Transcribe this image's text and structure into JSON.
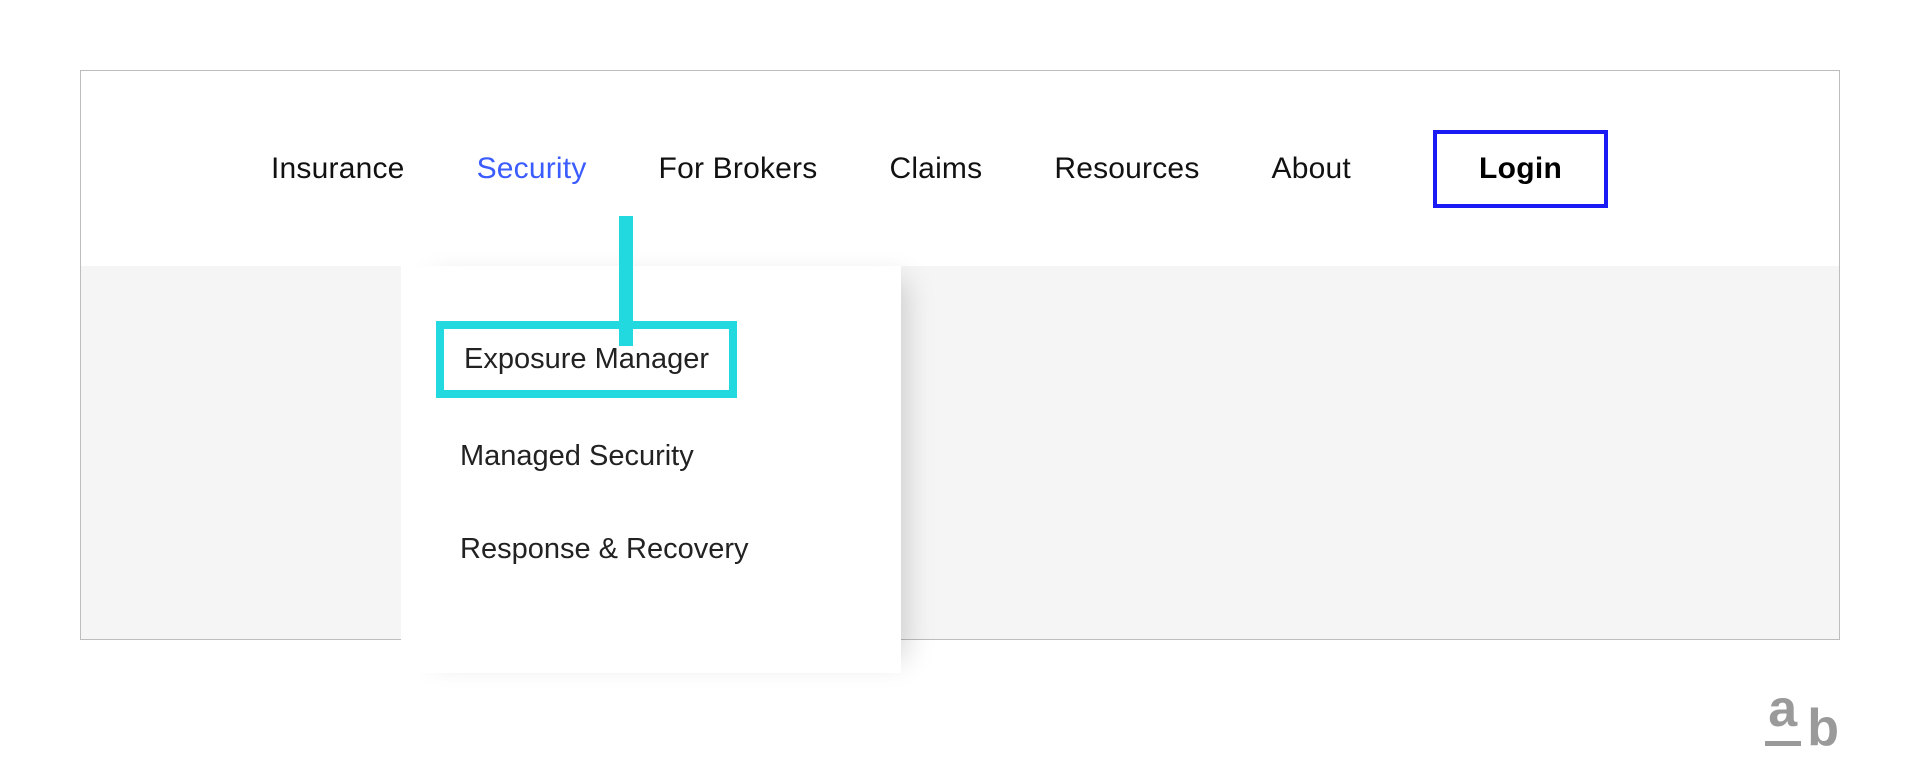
{
  "nav": {
    "items": [
      {
        "label": "Insurance",
        "active": false
      },
      {
        "label": "Security",
        "active": true
      },
      {
        "label": "For Brokers",
        "active": false
      },
      {
        "label": "Claims",
        "active": false
      },
      {
        "label": "Resources",
        "active": false
      },
      {
        "label": "About",
        "active": false
      }
    ],
    "login_label": "Login"
  },
  "dropdown": {
    "parent": "Security",
    "items": [
      {
        "label": "Exposure Manager",
        "highlighted": true
      },
      {
        "label": "Managed Security",
        "highlighted": false
      },
      {
        "label": "Response & Recovery",
        "highlighted": false
      }
    ]
  },
  "mark": {
    "a": "a",
    "b": "b"
  },
  "colors": {
    "accent_blue": "#1a1af5",
    "nav_active": "#3b5cff",
    "highlight_cyan": "#22d9e0",
    "content_bg": "#f5f5f5"
  }
}
